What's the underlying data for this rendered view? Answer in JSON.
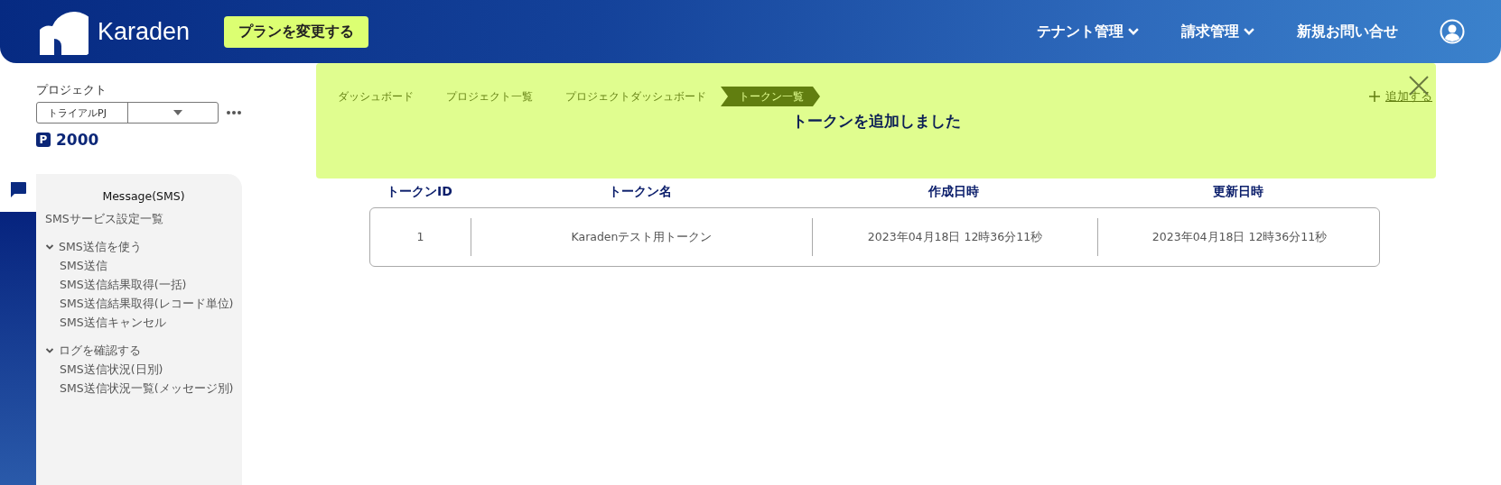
{
  "header": {
    "logo": "Karaden",
    "plan_button": "プランを変更する",
    "nav": [
      {
        "label": "テナント管理",
        "dropdown": true
      },
      {
        "label": "請求管理",
        "dropdown": true
      },
      {
        "label": "新規お問い合せ",
        "dropdown": false
      }
    ]
  },
  "project": {
    "label": "プロジェクト",
    "value": "トライアルPJ",
    "point_mark": "P",
    "points": "2000"
  },
  "sidebar": {
    "title": "Message(SMS)",
    "items": [
      {
        "label": "SMSサービス設定一覧"
      },
      {
        "label": "SMS送信を使う",
        "expanded": true,
        "children": [
          {
            "label": "SMS送信"
          },
          {
            "label": "SMS送信結果取得(一括)"
          },
          {
            "label": "SMS送信結果取得(レコード単位)"
          },
          {
            "label": "SMS送信キャンセル"
          }
        ]
      },
      {
        "label": "ログを確認する",
        "expanded": true,
        "children": [
          {
            "label": "SMS送信状況(日別)"
          },
          {
            "label": "SMS送信状況一覧(メッセージ別)"
          }
        ]
      }
    ]
  },
  "breadcrumbs": [
    {
      "label": "ダッシュボード",
      "selected": false
    },
    {
      "label": "プロジェクト一覧",
      "selected": false
    },
    {
      "label": "プロジェクトダッシュボード",
      "selected": false
    },
    {
      "label": "トークン一覧",
      "selected": true
    }
  ],
  "add_link": "追加する",
  "notification": {
    "message": "トークンを追加しました"
  },
  "table": {
    "columns": [
      "トークンID",
      "トークン名",
      "作成日時",
      "更新日時"
    ],
    "rows": [
      [
        "1",
        "Karadenテスト用トークン",
        "2023年04月18日 12時36分11秒",
        "2023年04月18日 12時36分11秒"
      ]
    ]
  }
}
